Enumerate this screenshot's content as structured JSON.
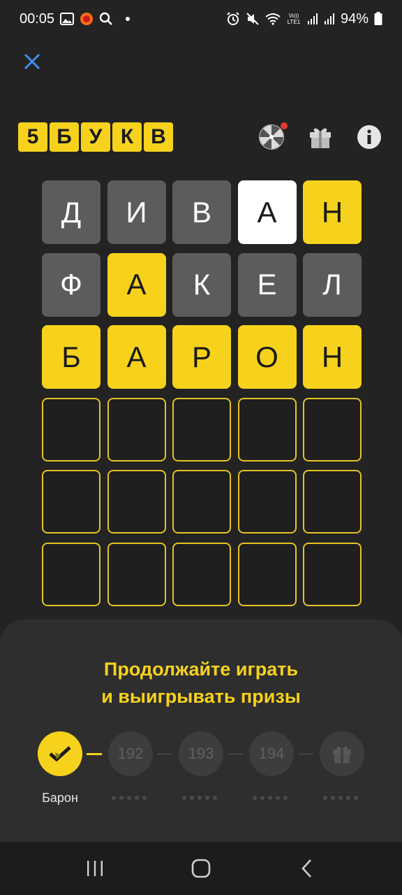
{
  "status_bar": {
    "time": "00:05",
    "battery": "94%",
    "volte": "Vo)) LTE1"
  },
  "header": {
    "logo_letters": [
      "5",
      "Б",
      "У",
      "К",
      "В"
    ]
  },
  "grid": {
    "rows": [
      [
        {
          "letter": "Д",
          "state": "gray"
        },
        {
          "letter": "И",
          "state": "gray"
        },
        {
          "letter": "В",
          "state": "gray"
        },
        {
          "letter": "А",
          "state": "white"
        },
        {
          "letter": "Н",
          "state": "yellow"
        }
      ],
      [
        {
          "letter": "Ф",
          "state": "gray"
        },
        {
          "letter": "А",
          "state": "yellow"
        },
        {
          "letter": "К",
          "state": "gray"
        },
        {
          "letter": "Е",
          "state": "gray"
        },
        {
          "letter": "Л",
          "state": "gray"
        }
      ],
      [
        {
          "letter": "Б",
          "state": "yellow"
        },
        {
          "letter": "А",
          "state": "yellow"
        },
        {
          "letter": "Р",
          "state": "yellow"
        },
        {
          "letter": "О",
          "state": "yellow"
        },
        {
          "letter": "Н",
          "state": "yellow"
        }
      ],
      [
        {
          "letter": "",
          "state": "empty"
        },
        {
          "letter": "",
          "state": "empty"
        },
        {
          "letter": "",
          "state": "empty"
        },
        {
          "letter": "",
          "state": "empty"
        },
        {
          "letter": "",
          "state": "empty"
        }
      ],
      [
        {
          "letter": "",
          "state": "empty"
        },
        {
          "letter": "",
          "state": "empty"
        },
        {
          "letter": "",
          "state": "empty"
        },
        {
          "letter": "",
          "state": "empty"
        },
        {
          "letter": "",
          "state": "empty"
        }
      ],
      [
        {
          "letter": "",
          "state": "empty"
        },
        {
          "letter": "",
          "state": "empty"
        },
        {
          "letter": "",
          "state": "empty"
        },
        {
          "letter": "",
          "state": "empty"
        },
        {
          "letter": "",
          "state": "empty"
        }
      ]
    ]
  },
  "sheet": {
    "title_line1": "Продолжайте играть",
    "title_line2": "и выигрывать призы",
    "solved_word": "Барон",
    "levels": [
      "192",
      "193",
      "194"
    ]
  },
  "colors": {
    "accent": "#f7d21c",
    "background": "#232323",
    "gray_tile": "#5c5c5c",
    "notification": "#e53935"
  }
}
